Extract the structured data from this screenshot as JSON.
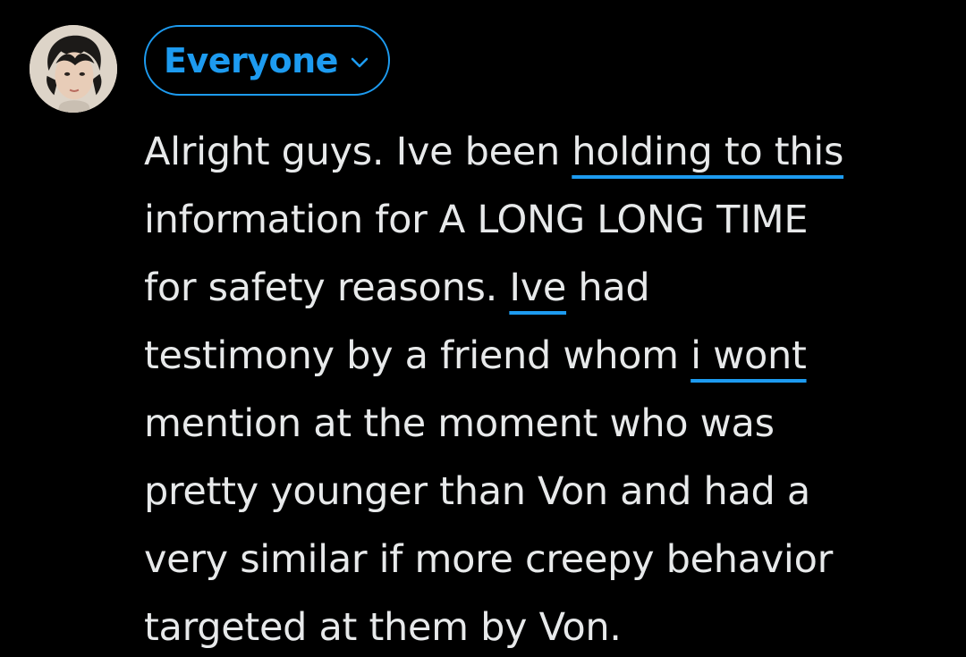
{
  "composer": {
    "audience_label": "Everyone",
    "accent_color": "#1d9bf0",
    "text_color": "#e7e9ea",
    "background_color": "#000000",
    "avatar_icon": "user-avatar",
    "chevron_icon": "chevron-down-icon",
    "text_lines": [
      [
        {
          "t": "Alright guys. Ive been ",
          "flag": false
        },
        {
          "t": "holding to this",
          "flag": true
        }
      ],
      [
        {
          "t": "information for A LONG LONG TIME",
          "flag": false
        }
      ],
      [
        {
          "t": "for safety reasons. ",
          "flag": false
        },
        {
          "t": "Ive",
          "flag": true
        },
        {
          "t": " had",
          "flag": false
        }
      ],
      [
        {
          "t": "testimony by a friend whom ",
          "flag": false
        },
        {
          "t": "i wont",
          "flag": true
        }
      ],
      [
        {
          "t": "mention at the moment who was",
          "flag": false
        }
      ],
      [
        {
          "t": "pretty younger than Von and had a",
          "flag": false
        }
      ],
      [
        {
          "t": "very similar if more creepy behavior",
          "flag": false
        }
      ],
      [
        {
          "t": "targeted at them by Von.",
          "flag": false
        }
      ]
    ]
  }
}
